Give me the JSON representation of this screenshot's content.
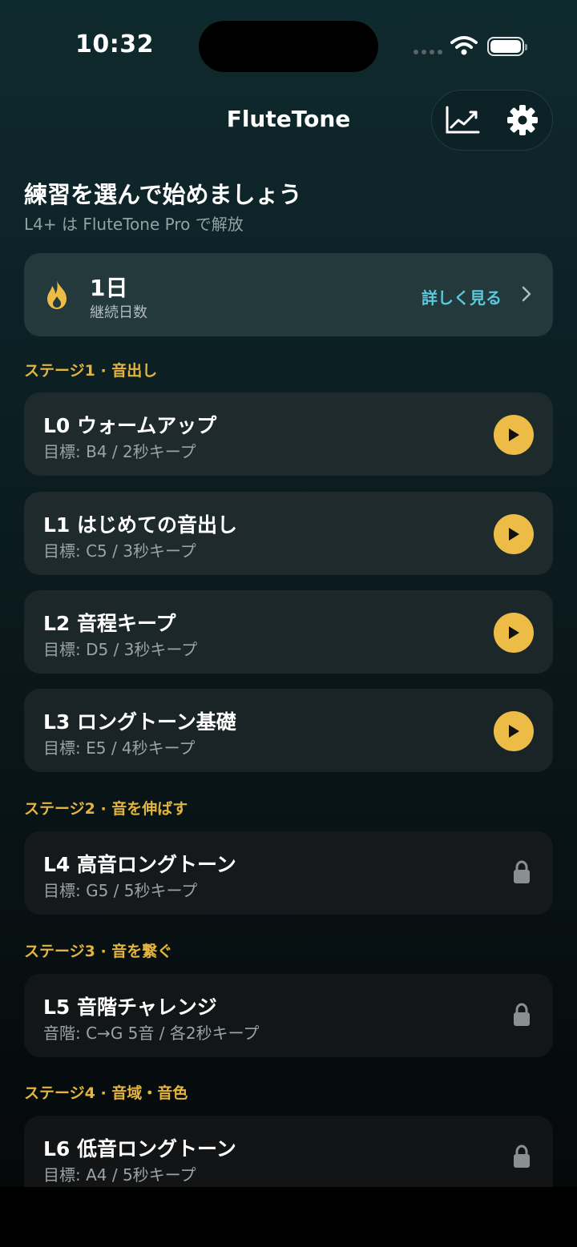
{
  "status": {
    "time": "10:32"
  },
  "app": {
    "title": "FluteTone",
    "actions": [
      {
        "name": "stats",
        "icon": "chart-icon"
      },
      {
        "name": "settings",
        "icon": "gear-icon"
      }
    ]
  },
  "intro": {
    "title": "練習を選んで始めましょう",
    "subtitle": "L4+ は FluteTone Pro で解放"
  },
  "streak": {
    "count": "1日",
    "label": "継続日数",
    "link": "詳しく見る",
    "icon": "flame-icon"
  },
  "sections": [
    {
      "title": "ステージ1 · 音出し"
    },
    {
      "title": "ステージ2 · 音を伸ばす"
    },
    {
      "title": "ステージ3 · 音を繋ぐ"
    },
    {
      "title": "ステージ4 · 音域・音色"
    }
  ],
  "lessons": [
    {
      "title": "L0 ウォームアップ",
      "subtitle": "目標: B4  /  2秒キープ",
      "locked": false
    },
    {
      "title": "L1 はじめての音出し",
      "subtitle": "目標: C5  /  3秒キープ",
      "locked": false
    },
    {
      "title": "L2 音程キープ",
      "subtitle": "目標: D5  /  3秒キープ",
      "locked": false
    },
    {
      "title": "L3 ロングトーン基礎",
      "subtitle": "目標: E5  /  4秒キープ",
      "locked": false
    },
    {
      "title": "L4 高音ロングトーン",
      "subtitle": "目標: G5  /  5秒キープ",
      "locked": true
    },
    {
      "title": "L5 音階チャレンジ",
      "subtitle": "音階: C→G  5音  /  各2秒キープ",
      "locked": true
    },
    {
      "title": "L6 低音ロングトーン",
      "subtitle": "目標: A4  /  5秒キープ",
      "locked": true
    }
  ],
  "colors": {
    "accent": "#ecbc47",
    "link": "#5bc8dc",
    "card_unlocked": "#1e2a2c",
    "card_locked": "#141819",
    "streak_card": "#24393c"
  }
}
